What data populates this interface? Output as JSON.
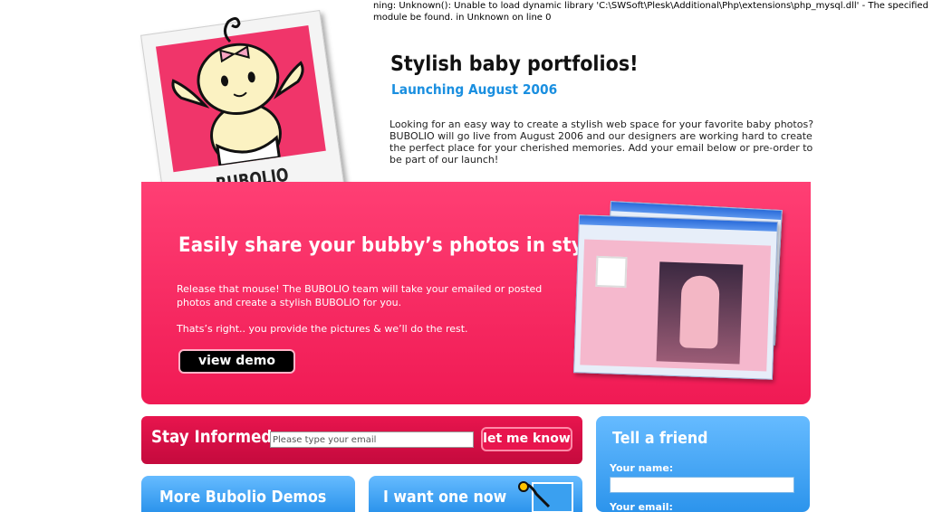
{
  "warning": {
    "text": "ning: Unknown(): Unable to load dynamic library 'C:\\SWSoft\\Plesk\\Additional\\Php\\extensions\\php_mysql.dll' - The specified module be found. in Unknown on line 0"
  },
  "logo": {
    "brand": "BUBOLIO"
  },
  "header": {
    "title": "Stylish baby portfolios!",
    "subtitle": "Launching August 2006",
    "intro": "Looking for an easy way to create a stylish web space for your favorite baby photos? BUBOLIO will go live from August 2006 and our designers are working hard to create the perfect place for your cherished memories. Add your email below or pre-order to be part of our launch!"
  },
  "hero": {
    "title": "Easily share your bubby’s photos in style",
    "text1": "Release that mouse! The BUBOLIO team will take your emailed or posted photos and create a stylish BUBOLIO for you.",
    "text2": "Thats’s right.. you provide the pictures & we’ll do the rest.",
    "demo_button": "view demo"
  },
  "stay_informed": {
    "label": "Stay Informed:",
    "placeholder": "Please type your email",
    "button": "let me know"
  },
  "boxes": {
    "more_demos": "More Bubolio Demos",
    "want_one": "I want one now",
    "tell_friend": {
      "title": "Tell a friend",
      "name_label": "Your name:",
      "email_label": "Your email:"
    }
  },
  "colors": {
    "pink": "#f01a54",
    "blue": "#2c94ec",
    "subtitle_blue": "#1a8fe0"
  }
}
